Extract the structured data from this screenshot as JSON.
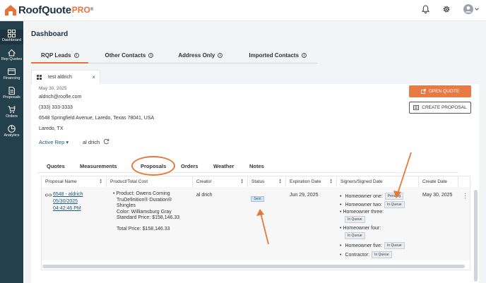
{
  "app": {
    "logo_text": "RoofQuote",
    "logo_pro": "PRO",
    "logo_tm": "®"
  },
  "sidebar": {
    "items": [
      {
        "label": "Dashboard",
        "icon": "dashboard-icon"
      },
      {
        "label": "Rep Quotes",
        "icon": "rep-quotes-icon"
      },
      {
        "label": "Financing",
        "icon": "financing-icon"
      },
      {
        "label": "Proposals",
        "icon": "proposals-icon"
      },
      {
        "label": "Orders",
        "icon": "orders-icon"
      },
      {
        "label": "Analytics",
        "icon": "analytics-icon"
      }
    ]
  },
  "page": {
    "title": "Dashboard"
  },
  "top_tabs": [
    {
      "label": "RQP Leads"
    },
    {
      "label": "Other Contacts"
    },
    {
      "label": "Address Only"
    },
    {
      "label": "Imported Contacts"
    }
  ],
  "contact_tab": {
    "label": "test aldrich",
    "close": "×"
  },
  "contact": {
    "date": "May 30, 2025",
    "email": "aldrich@roofle.com",
    "phone": "(333) 333-3333",
    "address": "6548 Springfield Avenue, Laredo, Texas 78041, USA",
    "city": "Laredo, TX",
    "active_rep_label": "Active Rep ▾",
    "rep_name": "al drich"
  },
  "buttons": {
    "open_quote": "OPEN QUOTE",
    "create_proposal": "CREATE PROPOSAL"
  },
  "sub_tabs": [
    {
      "label": "Quotes"
    },
    {
      "label": "Measurements"
    },
    {
      "label": "Proposals"
    },
    {
      "label": "Orders"
    },
    {
      "label": "Weather"
    },
    {
      "label": "Notes"
    }
  ],
  "table": {
    "headers": [
      "Proposal Name",
      "Product/Total Cost",
      "Creator",
      "Status",
      "Expiration Date",
      "Signers/Signed Date",
      "Create Date"
    ],
    "row": {
      "proposal_name_1": "6548 - aldrich",
      "proposal_name_2": "05/30/2025",
      "proposal_name_3": "04:42:46 PM",
      "product_1": "Product: Owens Corning",
      "product_2": "TruDefinition® Duration®",
      "product_3": "Shingles",
      "color": "Color: Williamsburg Gray",
      "standard_price": "Standard Price: $158,146.33",
      "total_price": "Total Price: $158,146.33",
      "creator": "al drich",
      "status": "Sent",
      "expiration": "Jun 29, 2025",
      "create_date": "May 30, 2025",
      "signers": [
        {
          "name": "Homeowner one:",
          "status": "Pending"
        },
        {
          "name": "Homeowner two:",
          "status": "In Queue"
        },
        {
          "name": "Homeowner three:",
          "status": "In Queue"
        },
        {
          "name": "Homeowner four:",
          "status": "In Queue"
        },
        {
          "name": "Homeowner five:",
          "status": "In Queue"
        },
        {
          "name": "Contractor:",
          "status": "In Queue"
        }
      ]
    }
  },
  "colors": {
    "accent": "#ea7a43",
    "sidebar": "#24404d",
    "link": "#1f5b7a",
    "annotation": "#e17a3a"
  }
}
